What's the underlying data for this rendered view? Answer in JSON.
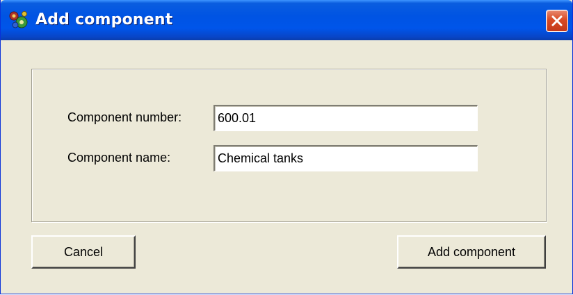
{
  "window": {
    "title": "Add component",
    "icon": "app-icon",
    "close_icon": "close-icon"
  },
  "form": {
    "component_number": {
      "label": "Component number:",
      "value": "600.01"
    },
    "component_name": {
      "label": "Component name:",
      "value": "Chemical tanks"
    }
  },
  "buttons": {
    "cancel": "Cancel",
    "add": "Add component"
  },
  "colors": {
    "titlebar": "#0054e3",
    "dialog_bg": "#ece9d8",
    "close_button": "#d84a24"
  }
}
